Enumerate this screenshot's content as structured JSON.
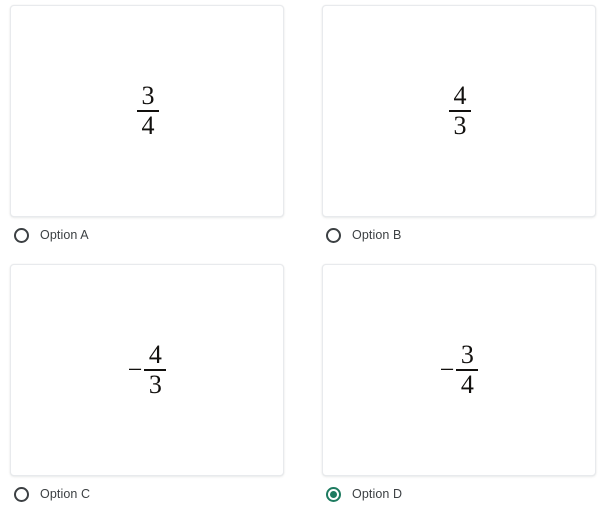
{
  "question": {
    "selected_option_id": "D",
    "accent_color_selected": "#1e7b60",
    "radio_color_unselected": "#3c4043",
    "card_background": "#ffffff",
    "card_border_color": "#e8eaed",
    "page_background": "#ffffff",
    "text_color": "#3c4043",
    "math_color": "#12100e"
  },
  "options": [
    {
      "id": "A",
      "label": "Option A",
      "radio_icon": "radio-unselected-icon",
      "selected": false,
      "value_text": "3/4",
      "sign": "",
      "numerator": "3",
      "denominator": "4"
    },
    {
      "id": "B",
      "label": "Option B",
      "radio_icon": "radio-unselected-icon",
      "selected": false,
      "value_text": "4/3",
      "sign": "",
      "numerator": "4",
      "denominator": "3"
    },
    {
      "id": "C",
      "label": "Option C",
      "radio_icon": "radio-unselected-icon",
      "selected": false,
      "value_text": "-4/3",
      "sign": "−",
      "numerator": "4",
      "denominator": "3"
    },
    {
      "id": "D",
      "label": "Option D",
      "radio_icon": "radio-selected-icon",
      "selected": true,
      "value_text": "-3/4",
      "sign": "−",
      "numerator": "3",
      "denominator": "4"
    }
  ]
}
